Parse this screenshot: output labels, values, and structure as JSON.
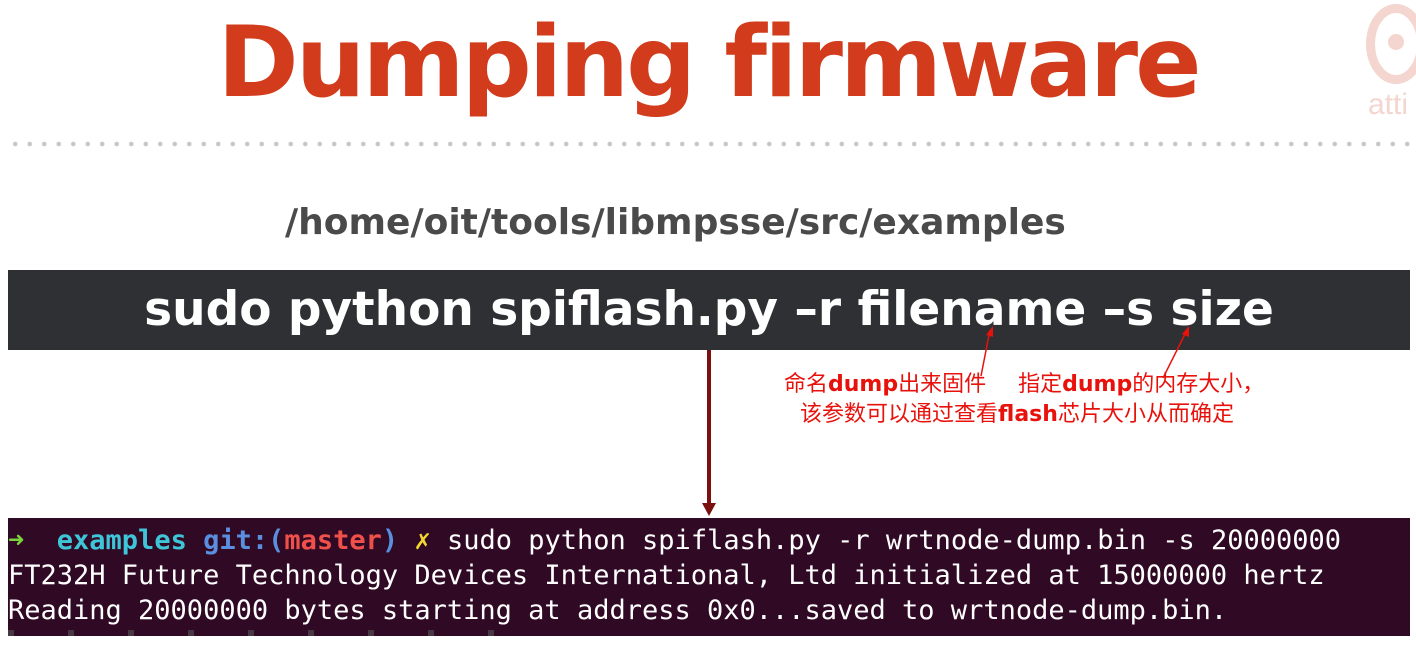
{
  "slide": {
    "title": "Dumping firmware",
    "logo_text": "atti",
    "path": "/home/oit/tools/libmpsse/src/examples",
    "command": "sudo python spiflash.py –r filename –s size"
  },
  "annotations": {
    "line1_part1": "命名",
    "line1_bold1": "dump",
    "line1_part2": "出来固件",
    "line1_part3": "指定",
    "line1_bold2": "dump",
    "line1_part4": "的内存大小，",
    "line2_part1": "该参数可以通过查看",
    "line2_bold": "flash",
    "line2_part2": "芯片大小从而确定"
  },
  "terminal": {
    "prompt_arrow": "➜",
    "prompt_dir": "examples",
    "prompt_git": "git:(",
    "prompt_branch": "master",
    "prompt_git_close": ")",
    "prompt_dirty": "✗",
    "line1_command": "sudo python spiflash.py -r wrtnode-dump.bin -s 20000000",
    "line2": "FT232H Future Technology Devices International, Ltd initialized at 15000000 hertz",
    "line3": "Reading 20000000 bytes starting at address 0x0...saved to wrtnode-dump.bin."
  },
  "colors": {
    "title": "#d23b1b",
    "annotation": "#e8120c",
    "arrow": "#7a1010",
    "terminal_bg": "#300a24",
    "command_bar_bg": "#2e3033"
  }
}
